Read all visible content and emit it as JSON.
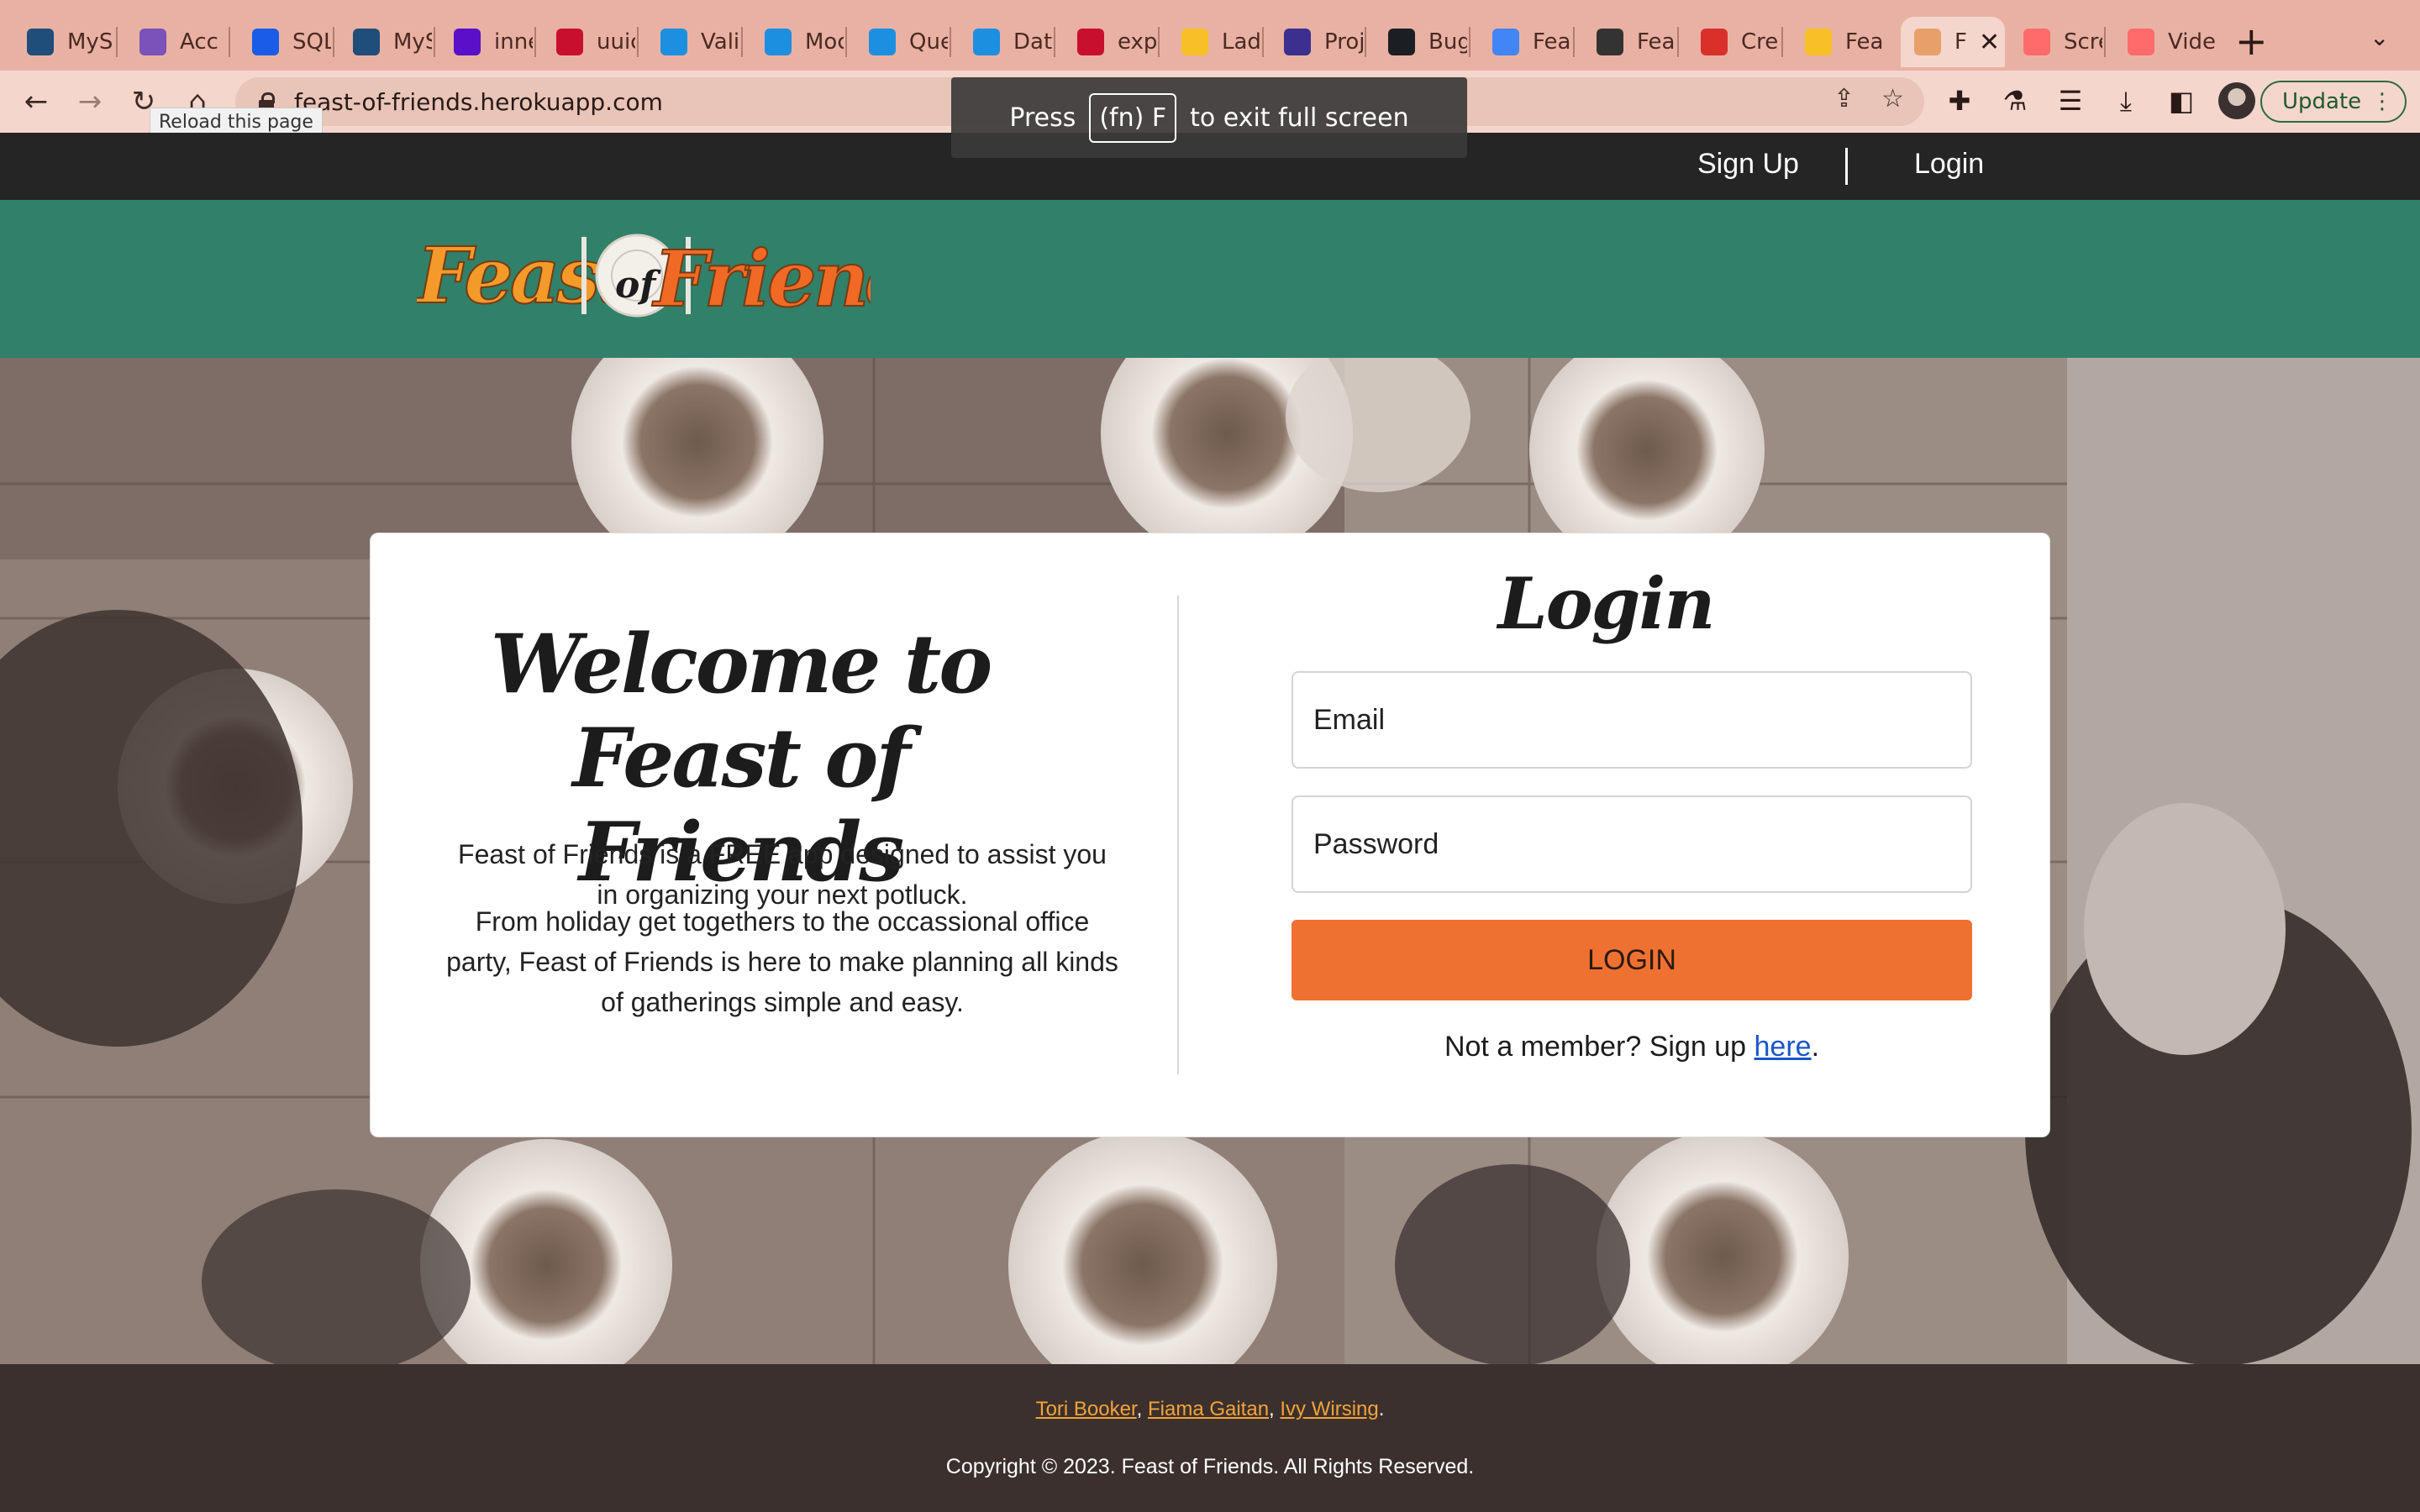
{
  "browser": {
    "tabs": [
      {
        "title": "MyS",
        "favicon_color": "#1e4e79"
      },
      {
        "title": "Acc",
        "favicon_color": "#7b52b9"
      },
      {
        "title": "SQL",
        "favicon_color": "#1a5ce8"
      },
      {
        "title": "MyS",
        "favicon_color": "#1e4e79"
      },
      {
        "title": "inne",
        "favicon_color": "#5a0fc8"
      },
      {
        "title": "uuic",
        "favicon_color": "#c8102e"
      },
      {
        "title": "Valic",
        "favicon_color": "#1d8fe1"
      },
      {
        "title": "Moc",
        "favicon_color": "#1d8fe1"
      },
      {
        "title": "Que",
        "favicon_color": "#1d8fe1"
      },
      {
        "title": "Data",
        "favicon_color": "#1d8fe1"
      },
      {
        "title": "exp",
        "favicon_color": "#c8102e"
      },
      {
        "title": "Lad",
        "favicon_color": "#f6c026"
      },
      {
        "title": "Proj",
        "favicon_color": "#3b2f8f"
      },
      {
        "title": "Bug",
        "favicon_color": "#1b1f23"
      },
      {
        "title": "Feat",
        "favicon_color": "#4285f4"
      },
      {
        "title": "Feat",
        "favicon_color": "#333333"
      },
      {
        "title": "Crea",
        "favicon_color": "#d9302c"
      },
      {
        "title": "Feat",
        "favicon_color": "#f6c026"
      },
      {
        "title": "F",
        "favicon_color": "#e8a06a",
        "active": true
      },
      {
        "title": "Scre",
        "favicon_color": "#ff6b6b"
      },
      {
        "title": "Vide",
        "favicon_color": "#ff6b6b"
      }
    ],
    "url": "feast-of-friends.herokuapp.com",
    "tooltip": "Reload this page",
    "update_label": "Update",
    "fullscreen_toast": {
      "prefix": "Press",
      "key": "(fn) F",
      "suffix": "to exit full screen"
    }
  },
  "nav": {
    "signup": "Sign Up",
    "login": "Login"
  },
  "logo": {
    "alt_text": "Feast of Friends"
  },
  "welcome": {
    "heading_line1": "Welcome to",
    "heading_line2": "Feast of Friends",
    "para1": "Feast of Friends is a FREE app designed to assist you in organizing your next potluck.",
    "para2": "From holiday get togethers to the occassional office party, Feast of Friends is here to make planning all kinds of gatherings simple and easy."
  },
  "login_form": {
    "title": "Login",
    "email_placeholder": "Email",
    "password_placeholder": "Password",
    "button_label": "LOGIN",
    "signup_prompt": "Not a member? Sign up",
    "signup_link": "here",
    "signup_suffix": "."
  },
  "footer": {
    "authors": [
      "Tori Booker",
      "Fiama Gaitan",
      "Ivy Wirsing"
    ],
    "copyright": "Copyright © 2023. Feast of Friends. All Rights Reserved."
  },
  "colors": {
    "header_green": "#318069",
    "accent_orange": "#ef7132",
    "footer_brown": "#3b302d",
    "link_gold": "#f2a33a"
  }
}
